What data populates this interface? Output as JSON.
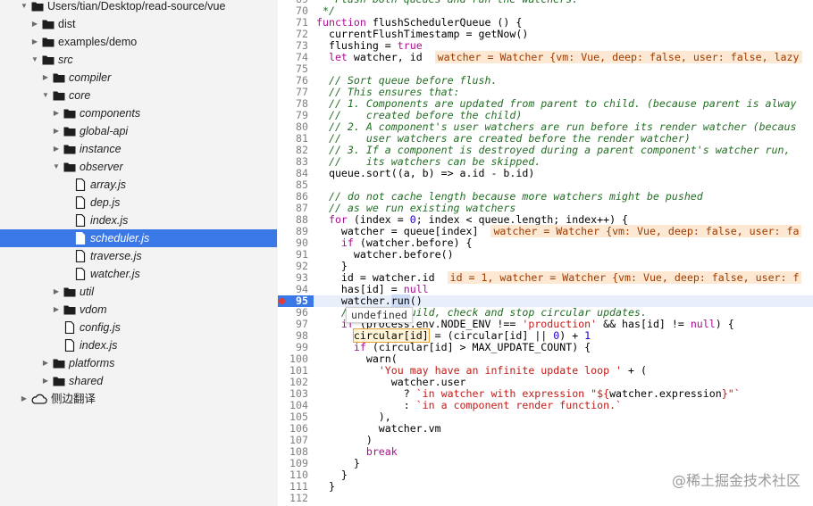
{
  "file_tree": [
    {
      "label": "Users/tian/Desktop/read-source/vue",
      "type": "folder",
      "expanded": true,
      "depth": 0,
      "italic": false
    },
    {
      "label": "dist",
      "type": "folder",
      "expanded": false,
      "depth": 1,
      "italic": false
    },
    {
      "label": "examples/demo",
      "type": "folder",
      "expanded": false,
      "depth": 1,
      "italic": false
    },
    {
      "label": "src",
      "type": "folder",
      "expanded": true,
      "depth": 1,
      "italic": true
    },
    {
      "label": "compiler",
      "type": "folder",
      "expanded": false,
      "depth": 2,
      "italic": true
    },
    {
      "label": "core",
      "type": "folder",
      "expanded": true,
      "depth": 2,
      "italic": true
    },
    {
      "label": "components",
      "type": "folder",
      "expanded": false,
      "depth": 3,
      "italic": true
    },
    {
      "label": "global-api",
      "type": "folder",
      "expanded": false,
      "depth": 3,
      "italic": true
    },
    {
      "label": "instance",
      "type": "folder",
      "expanded": false,
      "depth": 3,
      "italic": true
    },
    {
      "label": "observer",
      "type": "folder",
      "expanded": true,
      "depth": 3,
      "italic": true
    },
    {
      "label": "array.js",
      "type": "file",
      "depth": 4,
      "italic": true
    },
    {
      "label": "dep.js",
      "type": "file",
      "depth": 4,
      "italic": true
    },
    {
      "label": "index.js",
      "type": "file",
      "depth": 4,
      "italic": true
    },
    {
      "label": "scheduler.js",
      "type": "file",
      "depth": 4,
      "italic": true,
      "selected": true
    },
    {
      "label": "traverse.js",
      "type": "file",
      "depth": 4,
      "italic": true
    },
    {
      "label": "watcher.js",
      "type": "file",
      "depth": 4,
      "italic": true
    },
    {
      "label": "util",
      "type": "folder",
      "expanded": false,
      "depth": 3,
      "italic": true
    },
    {
      "label": "vdom",
      "type": "folder",
      "expanded": false,
      "depth": 3,
      "italic": true
    },
    {
      "label": "config.js",
      "type": "file",
      "depth": 3,
      "italic": true
    },
    {
      "label": "index.js",
      "type": "file",
      "depth": 3,
      "italic": true
    },
    {
      "label": "platforms",
      "type": "folder",
      "expanded": false,
      "depth": 2,
      "italic": true
    },
    {
      "label": "shared",
      "type": "folder",
      "expanded": false,
      "depth": 2,
      "italic": true
    },
    {
      "label": "侧边翻译",
      "type": "cloud",
      "expanded": false,
      "depth": 0,
      "italic": false
    }
  ],
  "editor": {
    "current_line": 95,
    "breakpoint_line": 95,
    "lines": [
      {
        "n": "69",
        "t": [
          [
            "cm",
            " * Flush both queues and run the watchers."
          ]
        ]
      },
      {
        "n": "70",
        "t": [
          [
            "cm",
            " */"
          ]
        ]
      },
      {
        "n": "71",
        "t": [
          [
            "kw",
            "function"
          ],
          [
            "",
            " flushSchedulerQueue () {"
          ]
        ]
      },
      {
        "n": "72",
        "t": [
          [
            "",
            "  currentFlushTimestamp = getNow()"
          ]
        ]
      },
      {
        "n": "73",
        "t": [
          [
            "",
            "  flushing = "
          ],
          [
            "kw",
            "true"
          ]
        ]
      },
      {
        "n": "74",
        "t": [
          [
            "",
            "  "
          ],
          [
            "kw",
            "let"
          ],
          [
            "",
            " watcher, id  "
          ],
          [
            "iv",
            "watcher = Watcher {vm: Vue, deep: false, user: false, lazy"
          ]
        ]
      },
      {
        "n": "75",
        "t": []
      },
      {
        "n": "76",
        "t": [
          [
            "cm",
            "  // Sort queue before flush."
          ]
        ]
      },
      {
        "n": "77",
        "t": [
          [
            "cm",
            "  // This ensures that:"
          ]
        ]
      },
      {
        "n": "78",
        "t": [
          [
            "cm",
            "  // 1. Components are updated from parent to child. (because parent is alway"
          ]
        ]
      },
      {
        "n": "79",
        "t": [
          [
            "cm",
            "  //    created before the child)"
          ]
        ]
      },
      {
        "n": "80",
        "t": [
          [
            "cm",
            "  // 2. A component's user watchers are run before its render watcher (becaus"
          ]
        ]
      },
      {
        "n": "81",
        "t": [
          [
            "cm",
            "  //    user watchers are created before the render watcher)"
          ]
        ]
      },
      {
        "n": "82",
        "t": [
          [
            "cm",
            "  // 3. If a component is destroyed during a parent component's watcher run,"
          ]
        ]
      },
      {
        "n": "83",
        "t": [
          [
            "cm",
            "  //    its watchers can be skipped."
          ]
        ]
      },
      {
        "n": "84",
        "t": [
          [
            "",
            "  queue.sort((a, b) => a.id - b.id)"
          ]
        ]
      },
      {
        "n": "85",
        "t": []
      },
      {
        "n": "86",
        "t": [
          [
            "cm",
            "  // do not cache length because more watchers might be pushed"
          ]
        ]
      },
      {
        "n": "87",
        "t": [
          [
            "cm",
            "  // as we run existing watchers"
          ]
        ]
      },
      {
        "n": "88",
        "t": [
          [
            "",
            "  "
          ],
          [
            "kw",
            "for"
          ],
          [
            "",
            " (index = "
          ],
          [
            "num",
            "0"
          ],
          [
            "",
            "; index < queue.length; index++) {"
          ]
        ]
      },
      {
        "n": "89",
        "t": [
          [
            "",
            "    watcher = queue[index]  "
          ],
          [
            "iv",
            "watcher = Watcher {vm: Vue, deep: false, user: fa"
          ]
        ]
      },
      {
        "n": "90",
        "t": [
          [
            "",
            "    "
          ],
          [
            "kw",
            "if"
          ],
          [
            "",
            " (watcher.before) {"
          ]
        ]
      },
      {
        "n": "91",
        "t": [
          [
            "",
            "      watcher.before()"
          ]
        ]
      },
      {
        "n": "92",
        "t": [
          [
            "",
            "    }"
          ]
        ]
      },
      {
        "n": "93",
        "t": [
          [
            "",
            "    id = watcher.id  "
          ],
          [
            "iv",
            "id = 1, watcher = Watcher {vm: Vue, deep: false, user: f"
          ]
        ]
      },
      {
        "n": "94",
        "t": [
          [
            "",
            "    has[id] = "
          ],
          [
            "kw",
            "null"
          ]
        ]
      },
      {
        "n": "95",
        "t": [
          [
            "",
            "    watcher."
          ],
          [
            "run",
            "run"
          ],
          [
            "",
            "()"
          ]
        ]
      },
      {
        "n": "96",
        "t": [
          [
            "cm",
            "    // in dev build, check and stop circular updates."
          ]
        ]
      },
      {
        "n": "97",
        "t": [
          [
            "",
            "    "
          ],
          [
            "kw",
            "if"
          ],
          [
            "",
            " (process.env.NODE_ENV !== "
          ],
          [
            "str",
            "'production'"
          ],
          [
            "",
            " && has[id] != "
          ],
          [
            "kw",
            "null"
          ],
          [
            "",
            ") {"
          ]
        ]
      },
      {
        "n": "98",
        "t": [
          [
            "",
            "      "
          ],
          [
            "box",
            "circular[id]"
          ],
          [
            "",
            " = (circular[id] || "
          ],
          [
            "num",
            "0"
          ],
          [
            "",
            ") + "
          ],
          [
            "num",
            "1"
          ]
        ]
      },
      {
        "n": "99",
        "t": [
          [
            "",
            "      "
          ],
          [
            "kw",
            "if"
          ],
          [
            "",
            " (circular[id] > MAX_UPDATE_COUNT) {"
          ]
        ]
      },
      {
        "n": "100",
        "t": [
          [
            "",
            "        warn("
          ]
        ]
      },
      {
        "n": "101",
        "t": [
          [
            "",
            "          "
          ],
          [
            "str",
            "'You may have an infinite update loop '"
          ],
          [
            "",
            " + ("
          ]
        ]
      },
      {
        "n": "102",
        "t": [
          [
            "",
            "            watcher.user"
          ]
        ]
      },
      {
        "n": "103",
        "t": [
          [
            "",
            "              ? "
          ],
          [
            "str",
            "`in watcher with expression \"${"
          ],
          [
            "",
            "watcher.expression"
          ],
          [
            "str",
            "}\"`"
          ]
        ]
      },
      {
        "n": "104",
        "t": [
          [
            "",
            "              : "
          ],
          [
            "str",
            "`in a component render function.`"
          ]
        ]
      },
      {
        "n": "105",
        "t": [
          [
            "",
            "          ),"
          ]
        ]
      },
      {
        "n": "106",
        "t": [
          [
            "",
            "          watcher.vm"
          ]
        ]
      },
      {
        "n": "107",
        "t": [
          [
            "",
            "        )"
          ]
        ]
      },
      {
        "n": "108",
        "t": [
          [
            "",
            "        "
          ],
          [
            "kw",
            "break"
          ]
        ]
      },
      {
        "n": "109",
        "t": [
          [
            "",
            "      }"
          ]
        ]
      },
      {
        "n": "110",
        "t": [
          [
            "",
            "    }"
          ]
        ]
      },
      {
        "n": "111",
        "t": [
          [
            "",
            "  }"
          ]
        ]
      },
      {
        "n": "112",
        "t": []
      }
    ]
  },
  "tooltip": {
    "text": "undefined"
  },
  "watermark": {
    "text": "@稀土掘金技术社区"
  },
  "colors": {
    "selection": "#3b78e7",
    "current_line": "#e8effb",
    "breakpoint": "#e53935",
    "inline_value_bg": "#fde8d4",
    "comment": "#236e25",
    "keyword": "#aa0d91",
    "string": "#c41a16"
  }
}
